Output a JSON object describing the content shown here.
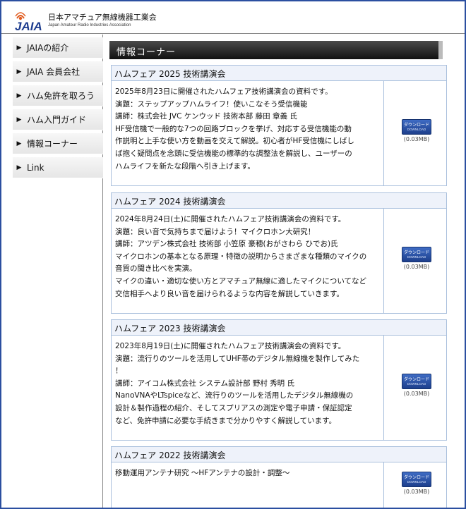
{
  "site": {
    "logo_text": "JAIA",
    "name": "日本アマチュア無線機器工業会",
    "name_en": "Japan Amateur Radio Industries Association"
  },
  "sidebar": {
    "items": [
      {
        "label": "JAIAの紹介"
      },
      {
        "label": "JAIA 会員会社"
      },
      {
        "label": "ハム免許を取ろう"
      },
      {
        "label": "ハム入門ガイド"
      },
      {
        "label": "情報コーナー"
      },
      {
        "label": "Link"
      }
    ]
  },
  "main": {
    "banner": "情報コーナー",
    "download": {
      "label": "ダウンロード",
      "label_en": "DOWNLOAD"
    },
    "sections": [
      {
        "title": "ハムフェア 2025 技術講演会",
        "lines": [
          "2025年8月23日に開催されたハムフェア技術講演会の資料です。",
          "演題：ステップアップハムライフ！使いこなそう受信機能",
          "講師：株式会社 JVC ケンウッド 技術本部 藤田 章義 氏",
          "HF受信機で一般的な7つの回路ブロックを挙げ、対応する受信機能の動",
          "作説明と上手な使い方を動画を交えて解説。初心者がHF受信機にしばし",
          "ば抱く疑問点を念頭に受信機能の標準的な調整法を解説し、ユーザーの",
          "ハムライフを新たな段階へ引き上げます。"
        ],
        "size": "(0.03MB)"
      },
      {
        "title": "ハムフェア 2024 技術講演会",
        "lines": [
          "2024年8月24日(土)に開催されたハムフェア技術講演会の資料です。",
          "演題：良い音で気持ちまで届けよう！マイクロホン大研究！",
          "講師：アツデン株式会社 技術部 小笠原 豪穂(おがさわら ひでお)氏",
          "マイクロホンの基本となる原理・特徴の説明からさまざまな種類のマイクの",
          "音質の聞き比べを実演。",
          "マイクの違い・適切な使い方とアマチュア無線に適したマイクについてなど",
          "交信相手へより良い音を届けられるような内容を解説していきます。"
        ],
        "size": "(0.03MB)"
      },
      {
        "title": "ハムフェア 2023 技術講演会",
        "lines": [
          "2023年8月19日(土)に開催されたハムフェア技術講演会の資料です。",
          "演題：流行りのツールを活用してUHF帯のデジタル無線機を製作してみた",
          "！",
          "講師：アイコム株式会社 システム設計部 野村 秀明 氏",
          "NanoVNAやLTspiceなど、流行りのツールを活用したデジタル無線機の",
          "設計＆製作過程の紹介、そしてスプリアスの測定や電子申請・保証認定",
          "など、免許申請に必要な手続きまで分かりやすく解説しています。"
        ],
        "size": "(0.03MB)"
      },
      {
        "title": "ハムフェア 2022 技術講演会",
        "lines": [
          "移動運用アンテナ研究 ～HFアンテナの設計・調整～"
        ],
        "size": "(0.03MB)"
      }
    ]
  },
  "colors": {
    "frame": "#2b4fa0",
    "section_header_bg": "#eef2fa",
    "section_border": "#aac0dd",
    "download_button": "#2d56a8",
    "logo_accent": "#e05a1e"
  },
  "icons": [
    "nav-arrow-icon",
    "logo-mark-icon",
    "download-button-icon"
  ]
}
